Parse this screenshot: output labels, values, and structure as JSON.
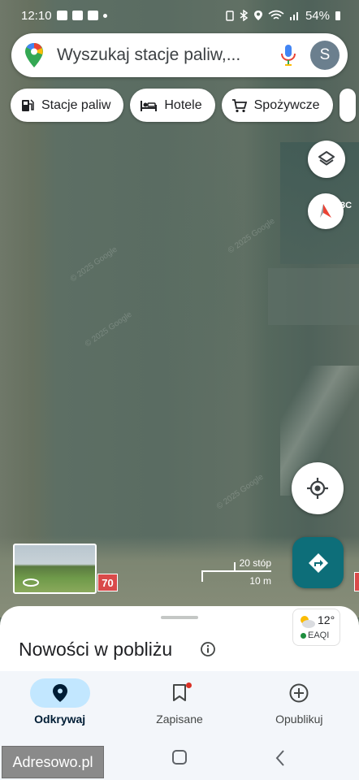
{
  "status_bar": {
    "time": "12:10",
    "battery": "54%"
  },
  "search": {
    "placeholder": "Wyszukaj stacje paliw,...",
    "avatar_letter": "S"
  },
  "chips": [
    {
      "label": "Stacje paliw",
      "icon": "gas-station-icon"
    },
    {
      "label": "Hotele",
      "icon": "bed-icon"
    },
    {
      "label": "Spożywcze",
      "icon": "cart-icon"
    }
  ],
  "map": {
    "watermark": "© 2025 Google",
    "edge_label": "3C",
    "speed_limit_left": "70",
    "scale": {
      "imperial": "20 stóp",
      "metric": "10 m"
    }
  },
  "sheet": {
    "title": "Nowości w pobliżu",
    "weather": {
      "temp": "12°",
      "aqi": "EAQI"
    }
  },
  "nav": {
    "items": [
      {
        "label": "Odkrywaj",
        "icon": "location-pin-icon",
        "active": true
      },
      {
        "label": "Zapisane",
        "icon": "bookmark-icon",
        "active": false
      },
      {
        "label": "Opublikuj",
        "icon": "add-circle-icon",
        "active": false
      }
    ]
  },
  "overlay": {
    "adresowo": "Adresowo.pl"
  },
  "colors": {
    "accent": "#0d6e79",
    "active_pill": "#c2e7ff",
    "speed_sign": "#d94a4a"
  }
}
